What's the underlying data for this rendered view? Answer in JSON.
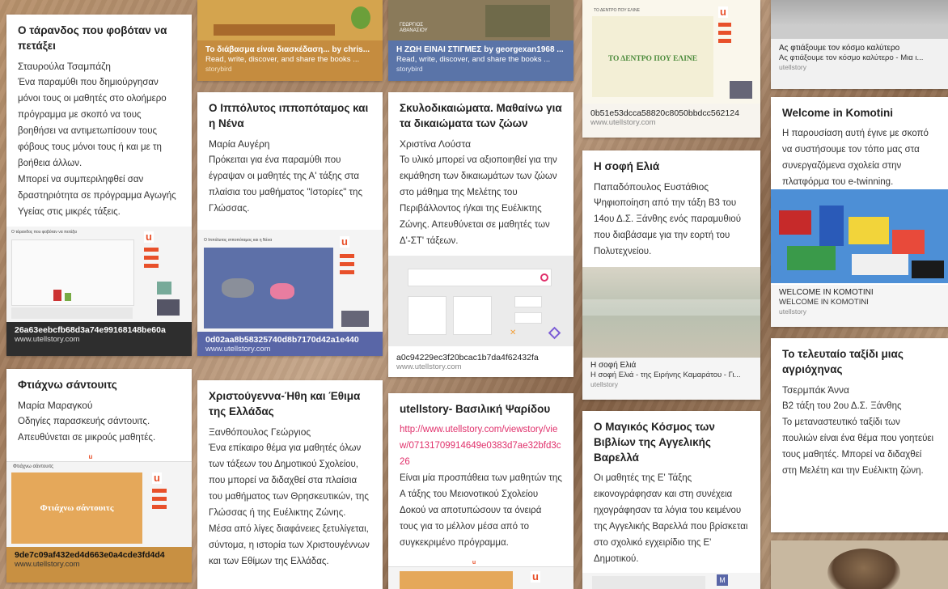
{
  "col1": [
    {
      "title": "Ο τάρανδος που φοβόταν να πετάξει",
      "author": "Σταυρούλα Τσαμπάζη",
      "desc": "Ένα παραμύθι που δημιούργησαν μόνοι τους οι μαθητές στο ολοήμερο πρόγραμμα με σκοπό να τους βοηθήσει να αντιμετωπίσουν τους φόβους τους μόνοι τους ή και με τη βοήθεια άλλων.\n Μπορεί να συμπεριληφθεί σαν δραστηριότητα σε πρόγραμμα Αγωγής Υγείας στις μικρές τάξεις.",
      "thumb_title": "Ο τάρανδος που φοβόταν να πετάξει",
      "cap1": "26a63eebcfb68d3a74e99168148be60a",
      "cap2": "www.utellstory.com"
    },
    {
      "title": "Φτιάχνω σάντουιτς",
      "author": "Μαρία Μαραγκού",
      "desc": "Οδηγίες παρασκευής σάντουιτς. Απευθύνεται σε μικρούς μαθητές.",
      "thumb_title": "Φτιάχνω σάντουιτς",
      "cap1": "9de7c09af432ed4d663e0a4cde3fd4d4",
      "cap2": "www.utellstory.com"
    }
  ],
  "col2": [
    {
      "cap1": "Το διάβασμα είναι διασκέδαση... by chris...",
      "cap2": "Read, write, discover, and share the books ...",
      "cap3": "storybird"
    },
    {
      "title": "Ο Ιππόλυτος ιπποπόταμος και η Νένα",
      "author": "Μαρία Αυγέρη",
      "desc": "Πρόκειται για ένα παραμύθι που έγραψαν οι μαθητές της Α' τάξης στα πλαίσια του μαθήματος \"Ιστορίες\" της Γλώσσας.",
      "thumb_title": "Ο Ιππόλυτος ιπποπόταμος και η Νένα",
      "cap1": "0d02aa8b58325740d8b7170d42a1e440",
      "cap2": "www.utellstory.com"
    },
    {
      "title": "Χριστούγεννα-Ήθη και Έθιμα της Ελλάδας",
      "author": "Ξανθόπουλος Γεώργιος",
      "desc": "Ένα επίκαιρο θέμα για μαθητές όλων των τάξεων του Δημοτικού Σχολείου, που μπορεί να διδαχθεί στα πλαίσια του μαθήματος των Θρησκευτικών, της Γλώσσας ή της Ευέλικτης Ζώνης. Μέσα από λίγες διαφάνειες ξετυλίγεται, σύντομα, η ιστορία των Χριστουγέννων και των Εθίμων της Ελλάδας."
    }
  ],
  "col3": [
    {
      "cap1": "Η ΖΩΗ ΕΙΝΑΙ ΣΤΙΓΜΕΣ by georgexan1968 ...",
      "cap2": "Read, write, discover, and share the books ...",
      "cap3": "storybird",
      "thumb_text": "ΓΕΩΡΓΙΟΣ ΑΘΑΝΑΣΙΟΥ"
    },
    {
      "title": "Σκυλοδικαιώματα. Μαθαίνω για τα δικαιώματα των ζώων",
      "author": "Χριστίνα Λούστα",
      "desc": "Το υλικό μπορεί να αξιοποιηθεί για την εκμάθηση των δικαιωμάτων των ζώων στο μάθημα της Μελέτης του Περιβάλλοντος ή/και της Ευέλικτης Ζώνης. Απευθύνεται σε μαθητές των Δ'-ΣΤ' τάξεων.",
      "cap1": "a0c94229ec3f20bcac1b7da4f62432fa",
      "cap2": "www.utellstory.com"
    },
    {
      "title": "utellstory- Βασιλική Ψαρίδου",
      "link": "http://www.utellstory.com/viewstory/view/07131709914649e0383d7ae32bfd3c26",
      "desc": "Είναι μία προσπάθεια των μαθητών της Α τάξης του Μειονοτικού Σχολείου Δοκού να αποτυπώσουν τα όνειρά τους για το μέλλον μέσα από το συγκεκριμένο πρόγραμμα."
    }
  ],
  "col4": [
    {
      "thumb_title": "ΤΟ ΔΕΝΤΡΟ ΠΟΥ ΕΛΙΝΕ",
      "thumb_big": "ΤΟ ΔΕΝΤΡΟ ΠΟΥ ΕΛΙΝΕ",
      "cap1": "0b51e53dcca58820c8050bbdcc562124",
      "cap2": "www.utellstory.com"
    },
    {
      "title": "Η σοφή Ελιά",
      "author": "Παπαδόπουλος Ευστάθιος",
      "desc": " Ψηφιοποίηση από την τάξη Β3 του 14ου Δ.Σ. Ξάνθης ενός παραμυθιού που διαβάσαμε για την εορτή του Πολυτεχνείου.",
      "cap1": "Η σοφή Ελιά",
      "cap2": "Η σοφή Ελιά - της Ειρήνης Καμαράτου - Γι...",
      "cap3": "utellstory"
    },
    {
      "title": "Ο Μαγικός Κόσμος των Βιβλίων της Αγγελικής Βαρελλά",
      "desc": "Οι μαθητές της Ε' Τάξης εικονογράφησαν και στη συνέχεια ηχογράφησαν τα λόγια του κειμένου της Αγγελικής Βαρελλά που βρίσκεται στο σχολικό εγχειρίδιο της Ε' Δημοτικού."
    }
  ],
  "col5": [
    {
      "cap1": "Ας φτιάξουμε τον κόσμο καλύτερο",
      "cap2": "Ας φτιάξουμε τον κόσμο καλύτερο - Μια ι...",
      "cap3": "utellstory"
    },
    {
      "title": "Welcome in Komotini",
      "desc": "Η παρουσίαση αυτή έγινε με σκοπό να συστήσουμε τον τόπο μας στα συνεργαζόμενα σχολεία στην πλατφόρμα του e-twinning.",
      "cap1": "WELCOME IN KOMOTINI",
      "cap2": "WELCOME IN KOMOTINI",
      "cap3": "utellstory"
    },
    {
      "title": "Το τελευταίο ταξίδι μιας αγριόχηνας",
      "author": "Τσερμπάκ Άννα",
      "desc": "Β2 τάξη του 2ου Δ.Σ. Ξάνθης\nΤο μεταναστευτικό ταξίδι των πουλιών είναι ένα θέμα που γοητεύει τους μαθητές. Μπορεί να διδαχθεί στη Μελέτη και την Ευέλικτη ζώνη."
    }
  ],
  "colors": {
    "accent": "#e8502a",
    "link": "#e0306b",
    "dark_caption": "#2e2e2e",
    "blue_caption": "#5966a7",
    "orange_caption": "#c89042",
    "storybird_blue": "#5a74a8"
  }
}
